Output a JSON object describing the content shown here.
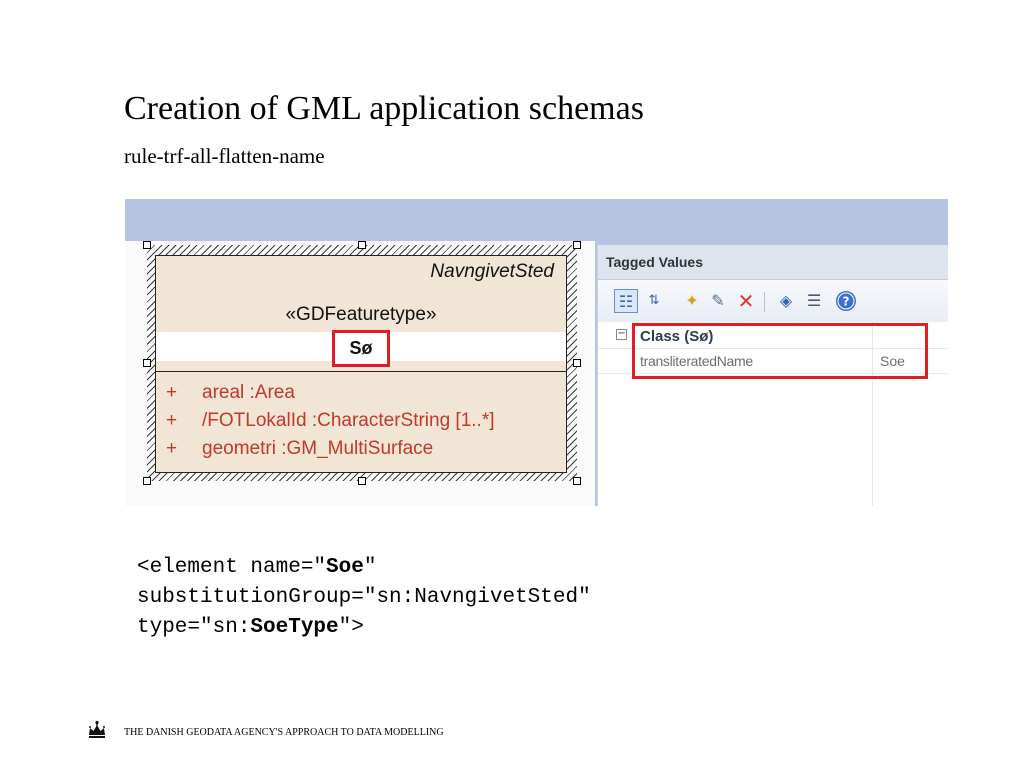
{
  "slide": {
    "title": "Creation of GML application schemas",
    "subtitle": "rule-trf-all-flatten-name"
  },
  "uml_class": {
    "supertype": "NavngivetSted",
    "stereotype": "«GDFeaturetype»",
    "name": "Sø",
    "highlight_color": "#e11d21",
    "attributes": [
      {
        "visibility": "+",
        "text": "areal  :Area"
      },
      {
        "visibility": "+",
        "text": "/FOTLokalId  :CharacterString [1..*]"
      },
      {
        "visibility": "+",
        "text": "geometri  :GM_MultiSurface"
      }
    ]
  },
  "tagged_values": {
    "title": "Tagged Values",
    "toolbar_icons": [
      "categorized-view-icon",
      "sort-alphabetical-icon",
      "new-tag-icon",
      "edit-tag-icon",
      "delete-tag-icon",
      "tag-options-icon",
      "show-inherited-icon",
      "help-icon"
    ],
    "group": {
      "expander": "−",
      "label": "Class (Sø)"
    },
    "rows": [
      {
        "key": "transliteratedName",
        "value": "Soe"
      }
    ]
  },
  "code": {
    "line1_prefix": "<element name=\"",
    "line1_name": "Soe",
    "line1_suffix": "\"",
    "line2": "substitutionGroup=\"sn:NavngivetSted\"",
    "line3_prefix": "type=\"sn:",
    "line3_type": "SoeType",
    "line3_suffix": "\">"
  },
  "footer": {
    "text": "THE DANISH GEODATA AGENCY'S APPROACH TO DATA MODELLING",
    "logo_icon": "crown-icon"
  }
}
